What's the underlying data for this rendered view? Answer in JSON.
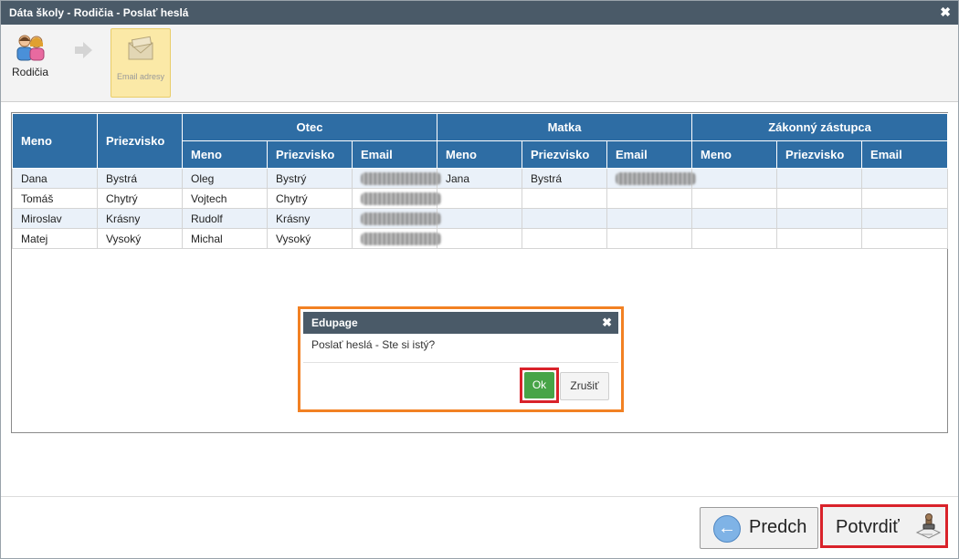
{
  "window": {
    "title": "Dáta školy - Rodičia - Poslať heslá",
    "close_glyph": "✖"
  },
  "steps": [
    {
      "label": "Rodičia",
      "icon": "parents-icon"
    },
    {
      "label": "Email adresy",
      "icon": "envelope-icon"
    }
  ],
  "table": {
    "col_headers": {
      "meno": "Meno",
      "priezvisko": "Priezvisko"
    },
    "groups": [
      "Otec",
      "Matka",
      "Zákonný zástupca"
    ],
    "sub_headers": [
      "Meno",
      "Priezvisko",
      "Email"
    ],
    "rows": [
      {
        "meno": "Dana",
        "priezvisko": "Bystrá",
        "otec_meno": "Oleg",
        "otec_priezvisko": "Bystrý",
        "matka_meno": "Jana",
        "matka_priezvisko": "Bystrá"
      },
      {
        "meno": "Tomáš",
        "priezvisko": "Chytrý",
        "otec_meno": "Vojtech",
        "otec_priezvisko": "Chytrý",
        "matka_meno": "",
        "matka_priezvisko": ""
      },
      {
        "meno": "Miroslav",
        "priezvisko": "Krásny",
        "otec_meno": "Rudolf",
        "otec_priezvisko": "Krásny",
        "matka_meno": "",
        "matka_priezvisko": ""
      },
      {
        "meno": "Matej",
        "priezvisko": "Vysoký",
        "otec_meno": "Michal",
        "otec_priezvisko": "Vysoký",
        "matka_meno": "",
        "matka_priezvisko": ""
      }
    ]
  },
  "dialog": {
    "title": "Edupage",
    "close_glyph": "✖",
    "message": "Poslať heslá - Ste si istý?",
    "ok_label": "Ok",
    "cancel_label": "Zrušiť"
  },
  "footer": {
    "back_label": "Predch",
    "confirm_label": "Potvrdiť"
  },
  "colors": {
    "header_bg": "#2e6da4",
    "title_bg": "#4a5a68",
    "highlight_red": "#d9222a",
    "dialog_border": "#f28123",
    "ok_green": "#47a447"
  }
}
